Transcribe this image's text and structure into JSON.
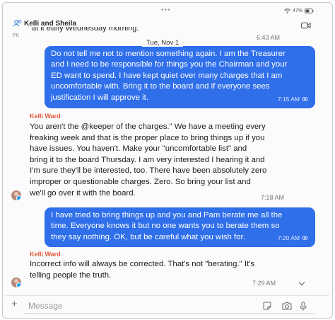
{
  "header": {
    "grabber": "•••",
    "battery": "47%",
    "title": "Kelli and Sheila",
    "initials": "PK"
  },
  "prev_message": {
    "text": "at it early Wednesday morning.",
    "time": "6:43 AM"
  },
  "date_divider": "Tue, Nov 1",
  "messages": [
    {
      "lines": [
        "Do not tell me not to mention something again. I am the Treasurer",
        "and I need to be responsible for things you the Chairman and your",
        "ED want to spend.  I have kept quiet over many charges that I am",
        "uncomfortable with.  Bring it to the board and if everyone sees",
        "justification I will approve it."
      ],
      "time": "7:15 AM"
    },
    {
      "sender": "Kelli Ward",
      "lines": [
        "You aren't the @keeper of the charges.\" We have a meeting every",
        "freaking week and that is the proper place to bring things up if you",
        "have issues. You haven't. Make your \"uncomfortable list\" and",
        "bring it to the board Thursday. I am very interested I hearing it and",
        "I'm sure they'll be interested, too. There have been absolutely zero",
        "improper or questionable charges. Zero. So bring your list and",
        "we'll go over it with the board."
      ],
      "time": "7:18 AM"
    },
    {
      "lines": [
        "I have tried to bring things up and you and Pam berate me all the",
        "time.  Everyone knows it but no one wants you to berate them so",
        "they say nothing.  OK, but be careful what you wish for."
      ],
      "time": "7:20 AM"
    },
    {
      "sender": "Kelli Ward",
      "lines": [
        "Incorrect info will always be corrected. That's not \"berating.\" It's",
        "telling people the truth."
      ],
      "time": "7:29 AM"
    }
  ],
  "composer": {
    "plus": "+",
    "placeholder": "Message"
  },
  "colors": {
    "outgoing_bubble": "#2f6fea",
    "sender_name": "#e05a3a",
    "accent": "#3a7bd5"
  },
  "icons": [
    "wifi-icon",
    "battery-icon",
    "group-avatar-icon",
    "video-icon",
    "read-receipt-icon",
    "chevron-down-icon",
    "plus-icon",
    "sticker-icon",
    "camera-icon",
    "microphone-icon"
  ]
}
